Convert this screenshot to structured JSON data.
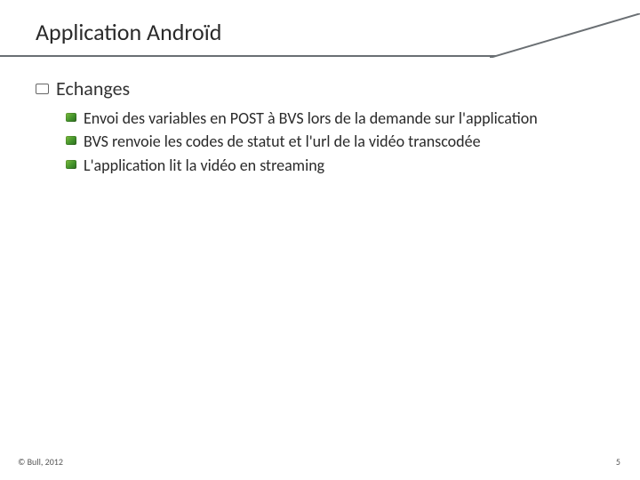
{
  "slide": {
    "title": "Application Androïd",
    "section": {
      "heading": "Echanges",
      "items": [
        "Envoi des variables en POST à BVS lors de la demande sur l'application",
        "BVS renvoie les codes de statut et l'url de la vidéo transcodée",
        "L'application lit la vidéo en streaming"
      ]
    },
    "footer": {
      "copyright": "© Bull, 2012",
      "page": "5"
    }
  }
}
